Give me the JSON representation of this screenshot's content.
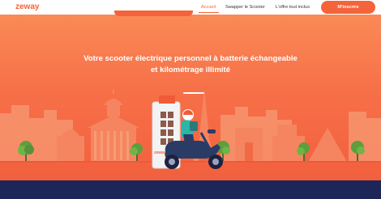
{
  "header": {
    "logo_text": "zeway",
    "nav": {
      "home": "Accueil",
      "swap": "Swapper le Scooter",
      "offer": "L'offre tout inclus"
    },
    "signup_label": "M'inscrire"
  },
  "hero": {
    "title_line1": "Votre scooter électrique personnel à batterie échangeable",
    "title_line2": "et kilométrage illimité",
    "station_brand": "zeway"
  },
  "colors": {
    "accent": "#f4633a",
    "hero_top": "#fa8a57",
    "hero_bottom": "#f2603e",
    "footer_band": "#1e2657"
  }
}
